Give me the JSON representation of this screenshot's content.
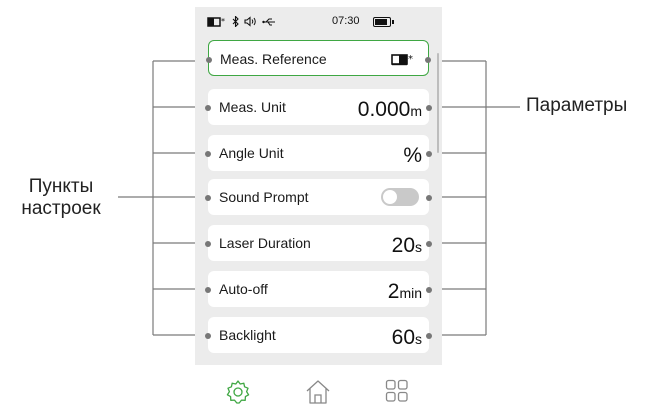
{
  "callouts": {
    "left_line1": "Пункты",
    "left_line2": "настроек",
    "right": "Параметры"
  },
  "status_bar": {
    "time": "07:30",
    "icons": [
      "laser-reference-icon",
      "bluetooth-icon",
      "sound-icon",
      "usb-icon",
      "battery-icon"
    ]
  },
  "settings": [
    {
      "label": "Meas. Reference",
      "value_icon": "laser-rear-reference-icon",
      "selected": true
    },
    {
      "label": "Meas. Unit",
      "value": "0.000",
      "unit": "m"
    },
    {
      "label": "Angle Unit",
      "value": "%",
      "unit": ""
    },
    {
      "label": "Sound Prompt",
      "toggle": "off"
    },
    {
      "label": "Laser Duration",
      "value": "20",
      "unit": "s"
    },
    {
      "label": "Auto-off",
      "value": "2",
      "unit": "min"
    },
    {
      "label": "Backlight",
      "value": "60",
      "unit": "s"
    }
  ],
  "bottom_nav": [
    "settings-gear-icon",
    "home-icon",
    "apps-grid-icon"
  ],
  "colors": {
    "accent_green": "#3fa743",
    "screen_bg": "#ececec",
    "leader_lines": "#7a7a7a"
  }
}
